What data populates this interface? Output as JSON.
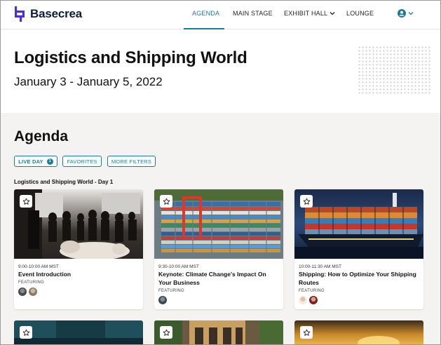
{
  "header": {
    "brand": "Basecrea",
    "nav": [
      "AGENDA",
      "MAIN STAGE",
      "EXHIBIT HALL",
      "LOUNGE"
    ],
    "active_nav": "AGENDA",
    "accent_color": "#1e7a95",
    "icons": {
      "user_menu": "user-circle-icon",
      "dropdown": "chevron-down-icon"
    }
  },
  "hero": {
    "title": "Logistics and Shipping World",
    "dates": "January 3 - January 5, 2022"
  },
  "agenda": {
    "title": "Agenda",
    "filters": {
      "live_day": "LIVE DAY",
      "live_day_count": "1",
      "favorites": "FAVORITES",
      "more_filters": "MORE FILTERS"
    },
    "day_label": "Logistics and Shipping World - Day 1",
    "featuring_label": "FEATURING",
    "sessions": [
      {
        "time": "9:00-10:00 AM MST",
        "title": "Event Introduction",
        "speaker_count": 2,
        "image": "conference-crowd-photo"
      },
      {
        "time": "9:30-10:00 AM MST",
        "title": "Keynote: Climate Change's Impact On Your Business",
        "speaker_count": 1,
        "image": "container-port-aerial-photo"
      },
      {
        "time": "10:00-11:30 AM MST",
        "title": "Shipping: How to Optimize Your Shipping Routes",
        "speaker_count": 2,
        "image": "cargo-ship-night-photo"
      }
    ],
    "more_sessions_images": [
      "teal-venue-photo",
      "building-facade-photo",
      "sunset-sky-photo"
    ]
  }
}
